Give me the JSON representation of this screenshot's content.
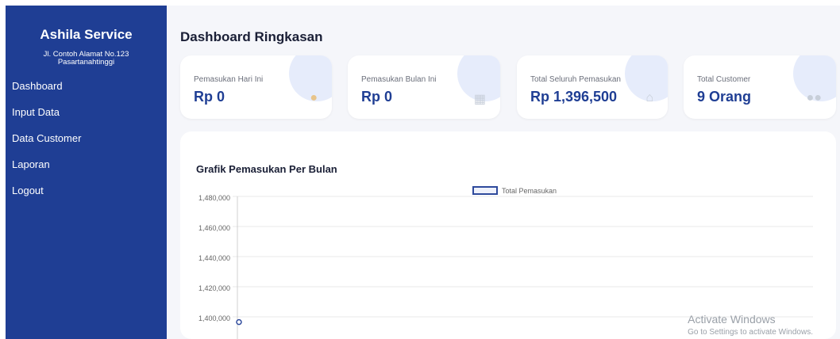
{
  "sidebar": {
    "brand": "Ashila Service",
    "address": [
      "Jl. Contoh Alamat No.123",
      "Pasartanahtinggi"
    ],
    "menu": [
      "Dashboard",
      "Input Data",
      "Data Customer",
      "Laporan",
      "Logout"
    ]
  },
  "main": {
    "title": "Dashboard Ringkasan",
    "cards": [
      {
        "label": "Pemasukan Hari Ini",
        "value": "Rp 0",
        "icon": "money-bag-icon"
      },
      {
        "label": "Pemasukan Bulan Ini",
        "value": "Rp 0",
        "icon": "calendar-icon"
      },
      {
        "label": "Total Seluruh Pemasukan",
        "value": "Rp 1,396,500",
        "icon": "bank-icon"
      },
      {
        "label": "Total Customer",
        "value": "9 Orang",
        "icon": "users-icon"
      }
    ],
    "chart_title": "Grafik Pemasukan Per Bulan"
  },
  "chart_data": {
    "type": "line",
    "title": "Grafik Pemasukan Per Bulan",
    "series": [
      {
        "name": "Total Pemasukan",
        "values": [
          1396500
        ]
      }
    ],
    "y_ticks": [
      "1,480,000",
      "1,460,000",
      "1,440,000",
      "1,420,000",
      "1,400,000"
    ],
    "ylim": [
      1380000,
      1480000
    ],
    "grid": true,
    "legend": "top-center",
    "colors": {
      "series": "#2e4a9c"
    }
  },
  "watermark": {
    "line1": "Activate Windows",
    "line2": "Go to Settings to activate Windows."
  }
}
